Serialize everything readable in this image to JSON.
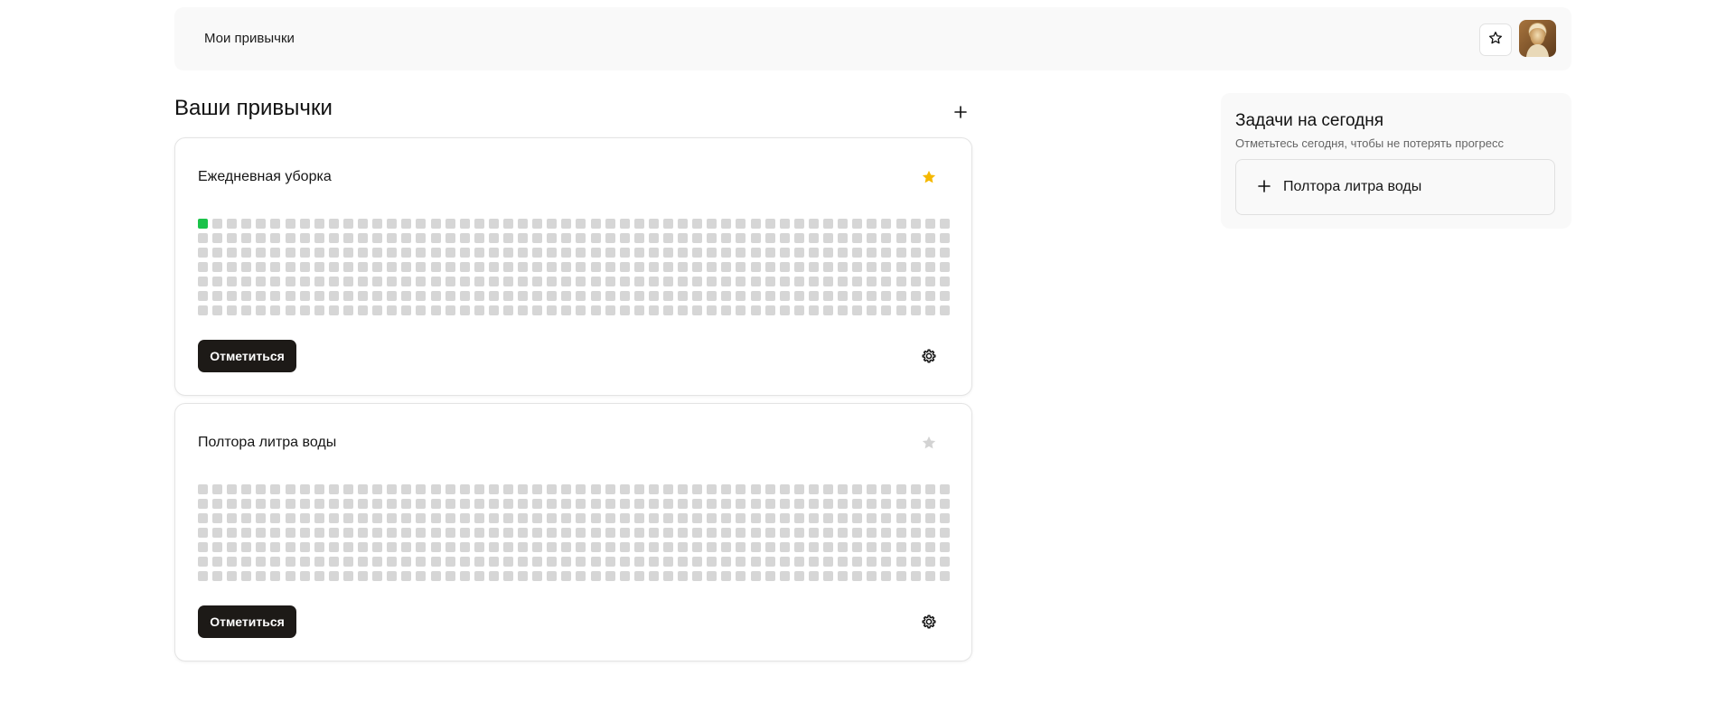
{
  "header": {
    "title": "Мои привычки",
    "favorites_icon": "star-outline-icon",
    "avatar_icon": "user-avatar"
  },
  "habits_section": {
    "title": "Ваши привычки",
    "add_icon": "plus-icon"
  },
  "habits": [
    {
      "name": "Ежедневная уборка",
      "favorite": true,
      "check_label": "Отметиться",
      "completed_days": [
        0
      ],
      "weeks": 52,
      "days_per_week": 7,
      "settings_icon": "gear-icon"
    },
    {
      "name": "Полтора литра воды",
      "favorite": false,
      "check_label": "Отметиться",
      "completed_days": [],
      "weeks": 52,
      "days_per_week": 7,
      "settings_icon": "gear-icon"
    }
  ],
  "tasks_panel": {
    "title": "Задачи на сегодня",
    "subtitle": "Отметьтесь сегодня, чтобы не потерять прогресс",
    "items": [
      {
        "label": "Полтора литра воды",
        "icon": "plus-icon"
      }
    ]
  },
  "colors": {
    "completed_cell": "#1bc34a",
    "empty_cell": "#d6d6d6",
    "favorite_star": "#f5b800",
    "unfavorite_star": "#d3d3d3",
    "primary_button": "#1d1a17"
  }
}
